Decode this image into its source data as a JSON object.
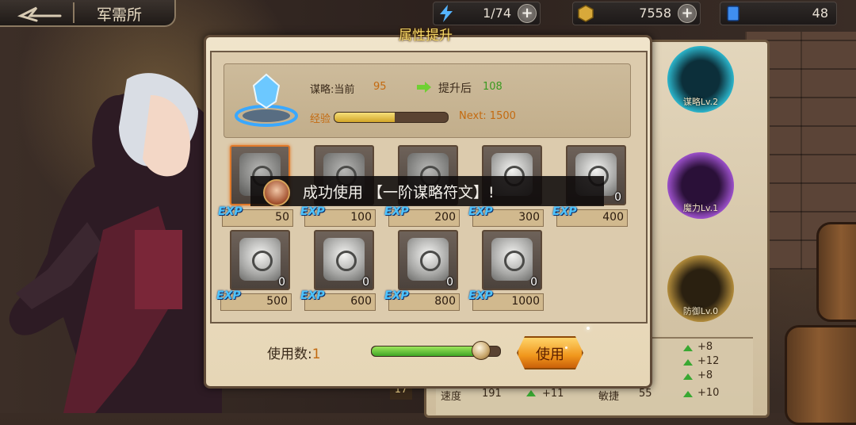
{
  "top_bar": {
    "title": "军需所",
    "resources": [
      {
        "icon": "energy-bolt-icon",
        "value": "1/74",
        "has_plus": true
      },
      {
        "icon": "gold-coin-icon",
        "value": "7558",
        "has_plus": true
      },
      {
        "icon": "blue-gem-icon",
        "value": "48",
        "has_plus": false
      }
    ]
  },
  "dialog": {
    "title": "属性提升",
    "attribute_label": "谋略:当前",
    "current_value": "95",
    "after_label": "提升后",
    "after_value": "108",
    "exp_label": "经验",
    "exp_progress": 0.53,
    "next_label": "Next: 1500",
    "items": [
      {
        "exp": "50",
        "count": "",
        "selected": true
      },
      {
        "exp": "100",
        "count": "",
        "selected": false
      },
      {
        "exp": "200",
        "count": "",
        "selected": false
      },
      {
        "exp": "300",
        "count": "",
        "selected": false
      },
      {
        "exp": "400",
        "count": "0",
        "selected": false
      },
      {
        "exp": "500",
        "count": "0",
        "selected": false
      },
      {
        "exp": "600",
        "count": "0",
        "selected": false
      },
      {
        "exp": "800",
        "count": "0",
        "selected": false
      },
      {
        "exp": "1000",
        "count": "0",
        "selected": false
      }
    ],
    "exp_tag": "EXP",
    "use_count_label": "使用数:",
    "use_count": "1",
    "use_slider_value": 0.85,
    "use_button": "使用"
  },
  "toast": {
    "message": "成功使用 【一阶谋略符文】!"
  },
  "side_panel": {
    "runes": [
      {
        "label": "谋略Lv.2",
        "color": "#2bb3c9"
      },
      {
        "label": "魔力Lv.1",
        "color": "#9a4fc8"
      },
      {
        "label": "防御Lv.0",
        "color": "#b08a3a"
      }
    ],
    "stats_bonus": [
      "+8",
      "+12",
      "+8",
      "+10"
    ],
    "speed_label": "速度",
    "speed_value": "191",
    "speed_bonus": "+11",
    "agility_label": "敏捷",
    "agility_value": "55",
    "left_badge": "17"
  }
}
